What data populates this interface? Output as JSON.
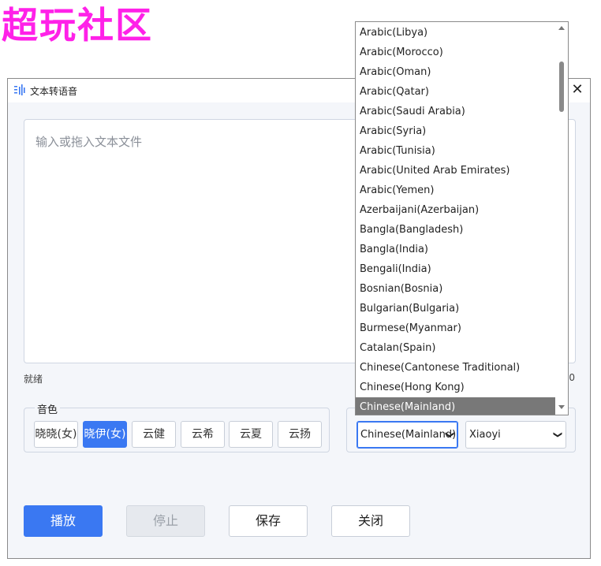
{
  "watermark": "超玩社区",
  "window": {
    "title": "文本转语音"
  },
  "editor": {
    "placeholder": "输入或拖入文本文件"
  },
  "status": "就绪",
  "char_count": "0",
  "voice": {
    "legend": "音色",
    "options": [
      "晓晓(女)",
      "晓伊(女)",
      "云健",
      "云希",
      "云夏",
      "云扬"
    ],
    "selected_index": 1
  },
  "language_select": {
    "value": "Chinese(Mainland)"
  },
  "voice_select": {
    "value": "Xiaoyi"
  },
  "buttons": {
    "play": "播放",
    "stop": "停止",
    "save": "保存",
    "close": "关闭"
  },
  "dropdown": {
    "items": [
      "Arabic(Libya)",
      "Arabic(Morocco)",
      "Arabic(Oman)",
      "Arabic(Qatar)",
      "Arabic(Saudi Arabia)",
      "Arabic(Syria)",
      "Arabic(Tunisia)",
      "Arabic(United Arab Emirates)",
      "Arabic(Yemen)",
      "Azerbaijani(Azerbaijan)",
      "Bangla(Bangladesh)",
      "Bangla(India)",
      "Bengali(India)",
      "Bosnian(Bosnia)",
      "Bulgarian(Bulgaria)",
      "Burmese(Myanmar)",
      "Catalan(Spain)",
      "Chinese(Cantonese Traditional)",
      "Chinese(Hong Kong)",
      "Chinese(Mainland)"
    ],
    "selected": "Chinese(Mainland)"
  },
  "colors": {
    "accent": "#3a78f2",
    "watermark": "#ff21e8",
    "selected_item_bg": "#787878"
  }
}
